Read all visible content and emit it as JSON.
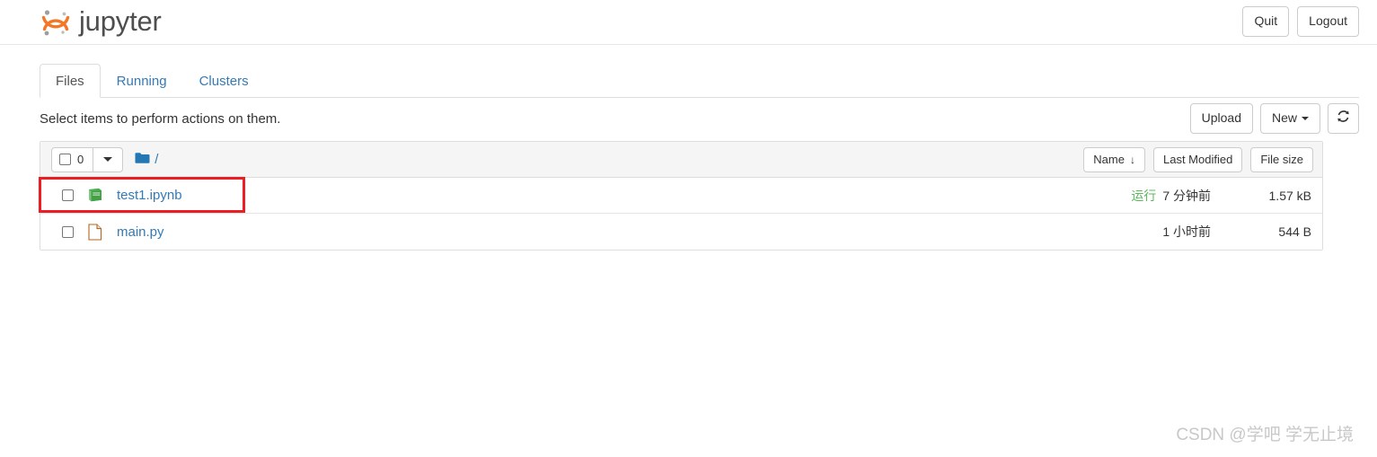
{
  "header": {
    "brand_name": "jupyter",
    "logo_icon": "jupyter-logo-icon",
    "quit_label": "Quit",
    "logout_label": "Logout"
  },
  "tabs": [
    {
      "label": "Files",
      "active": true
    },
    {
      "label": "Running",
      "active": false
    },
    {
      "label": "Clusters",
      "active": false
    }
  ],
  "actions": {
    "message": "Select items to perform actions on them.",
    "upload_label": "Upload",
    "new_label": "New",
    "new_caret_icon": "chevron-down-icon",
    "refresh_icon": "refresh-icon"
  },
  "file_list": {
    "toolbar": {
      "select_all_checkbox_icon": "checkbox-unchecked-icon",
      "selected_count": "0",
      "dropdown_caret_icon": "caret-down-icon",
      "folder_icon": "folder-icon",
      "breadcrumb_path": "/",
      "sort_name_label": "Name",
      "sort_name_arrow": "↓",
      "sort_modified_label": "Last Modified",
      "sort_size_label": "File size"
    },
    "columns": [
      "Name",
      "Last Modified",
      "File size"
    ],
    "rows": [
      {
        "checkbox_icon": "checkbox-unchecked-icon",
        "icon": "notebook-icon",
        "name": "test1.ipynb",
        "status": "运行",
        "modified": "7 分钟前",
        "size": "1.57 kB",
        "highlighted": true
      },
      {
        "checkbox_icon": "checkbox-unchecked-icon",
        "icon": "file-icon",
        "name": "main.py",
        "status": "",
        "modified": "1 小时前",
        "size": "544 B",
        "highlighted": false
      }
    ]
  },
  "watermark": {
    "text": "CSDN @学吧 学无止境"
  },
  "colors": {
    "brand_orange": "#f37726",
    "link_blue": "#337ab7",
    "running_green": "#5cb85c",
    "highlight_red": "#ee1d23",
    "folder_blue": "#2477b3"
  }
}
